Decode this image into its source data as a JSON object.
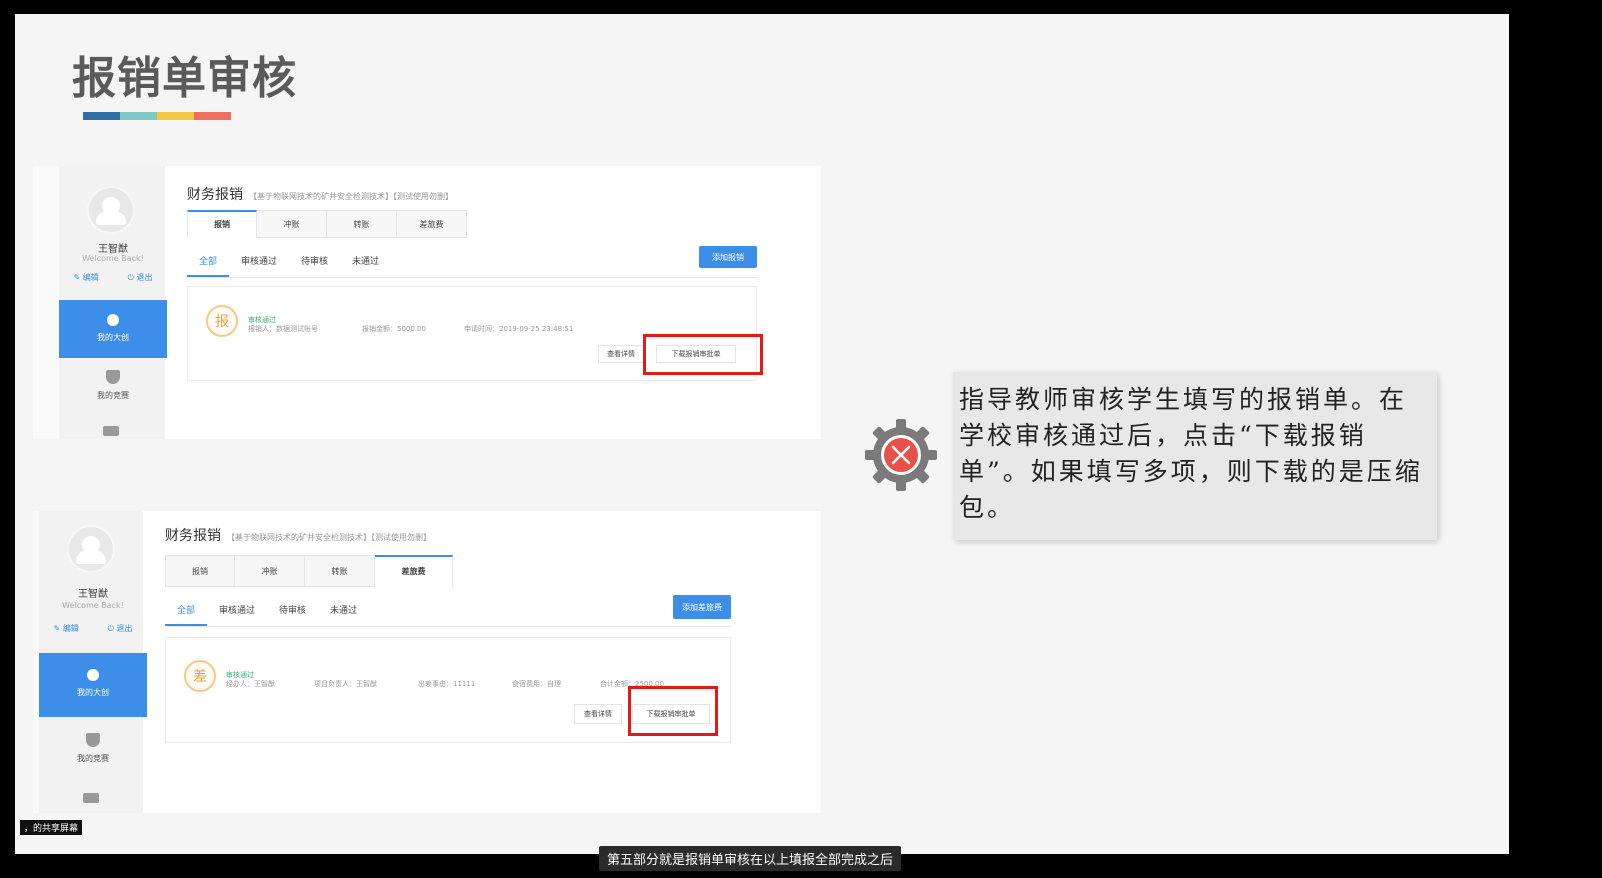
{
  "slide": {
    "title": "报销单审核",
    "colorbar": [
      "#2f6ea6",
      "#7fc9c5",
      "#f5c842",
      "#ef6f5f"
    ]
  },
  "screenshot1": {
    "user": {
      "name": "王智猷",
      "welcome": "Welcome Back!",
      "edit": "编辑",
      "logout": "退出"
    },
    "nav": {
      "active": "我的大创",
      "competition": "我的竞赛"
    },
    "header": {
      "title": "财务报销",
      "subtitle": "【基于物联网技术的矿井安全检测技术】【测试使用勿删】"
    },
    "tabs": [
      "报销",
      "冲账",
      "转账",
      "差旅费"
    ],
    "filters": [
      "全部",
      "审核通过",
      "待审核",
      "未通过"
    ],
    "add_button": "添加报销",
    "card": {
      "badge": "报",
      "status": "审核通过",
      "applicant": "报销人：数据测试账号",
      "amount": "报销金额：5000.00",
      "time": "申请时间：2019-09-25 23:48:51",
      "detail_button": "查看详情",
      "download_button": "下载报销审批单"
    }
  },
  "screenshot2": {
    "user": {
      "name": "王智猷",
      "welcome": "Welcome Back!",
      "edit": "编辑",
      "logout": "退出"
    },
    "nav": {
      "active": "我的大创",
      "competition": "我的竞赛"
    },
    "header": {
      "title": "财务报销",
      "subtitle": "【基于物联网技术的矿井安全检测技术】【测试使用勿删】"
    },
    "tabs": [
      "报销",
      "冲账",
      "转账",
      "差旅费"
    ],
    "filters": [
      "全部",
      "审核通过",
      "待审核",
      "未通过"
    ],
    "add_button": "添加差旅费",
    "card": {
      "badge": "差",
      "status": "审核通过",
      "handler": "经办人：王智猷",
      "leader": "项目负责人：王智猷",
      "reason": "出差事由：11111",
      "lodging": "食宿费用：自理",
      "total": "合计金额：2500.00",
      "detail_button": "查看详情",
      "download_button": "下载报销审批单"
    }
  },
  "note": {
    "text": "指导教师审核学生填写的报销单。在学校审核通过后，点击“下载报销单”。如果填写多项，则下载的是压缩包。"
  },
  "overlay": {
    "share_tag": "，的共享屏幕",
    "subtitle": "第五部分就是报销单审核在以上填报全部完成之后"
  }
}
